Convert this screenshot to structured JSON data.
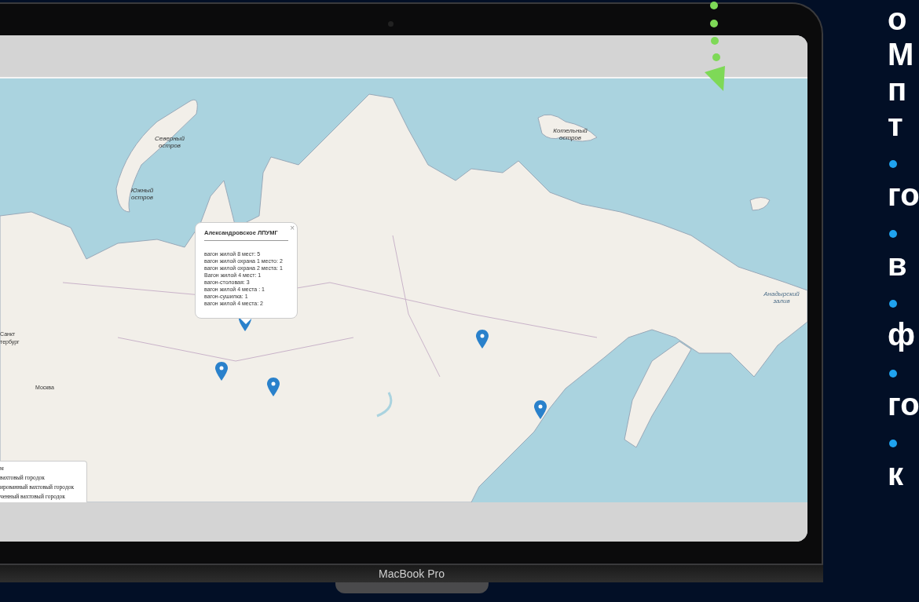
{
  "side_text": [
    {
      "kind": "line",
      "text": "о"
    },
    {
      "kind": "line",
      "text": "М"
    },
    {
      "kind": "line",
      "text": "п"
    },
    {
      "kind": "line",
      "text": "т"
    },
    {
      "kind": "bullet"
    },
    {
      "kind": "line",
      "text": "го"
    },
    {
      "kind": "bullet"
    },
    {
      "kind": "line",
      "text": "в"
    },
    {
      "kind": "bullet"
    },
    {
      "kind": "line",
      "text": "ф"
    },
    {
      "kind": "bullet"
    },
    {
      "kind": "line",
      "text": "го"
    },
    {
      "kind": "bullet"
    },
    {
      "kind": "line",
      "text": "к"
    }
  ],
  "laptop": {
    "model": "MacBook Pro"
  },
  "map": {
    "labels": [
      {
        "kind": "island",
        "text": "Северный остров"
      },
      {
        "kind": "island",
        "text": "Южный остров"
      },
      {
        "kind": "island",
        "text": "Котельный остров"
      },
      {
        "kind": "water",
        "text": "Анадырский залив"
      },
      {
        "kind": "city",
        "text": "Санкт"
      },
      {
        "kind": "city",
        "text": "тербург"
      },
      {
        "kind": "city",
        "text": "Москва"
      }
    ],
    "popup": {
      "title": "Александровское ЛПУМГ",
      "close": "×",
      "lines": [
        "вагон жилой 8 мест: 5",
        "вагон жилой охрана 1 место: 2",
        "вагон жилой охрана 2 места: 1",
        "Вагон жилой 4 мест: 1",
        "вагон-столовая: 3",
        "вагон жилой 4 места : 1",
        "вагон-сушилка: 1",
        "вагон жилой 4 места: 2"
      ]
    },
    "legend": [
      "м",
      "вахтовый городок",
      "ированный вахтовый городок",
      "ченный вахтовый городок"
    ]
  }
}
